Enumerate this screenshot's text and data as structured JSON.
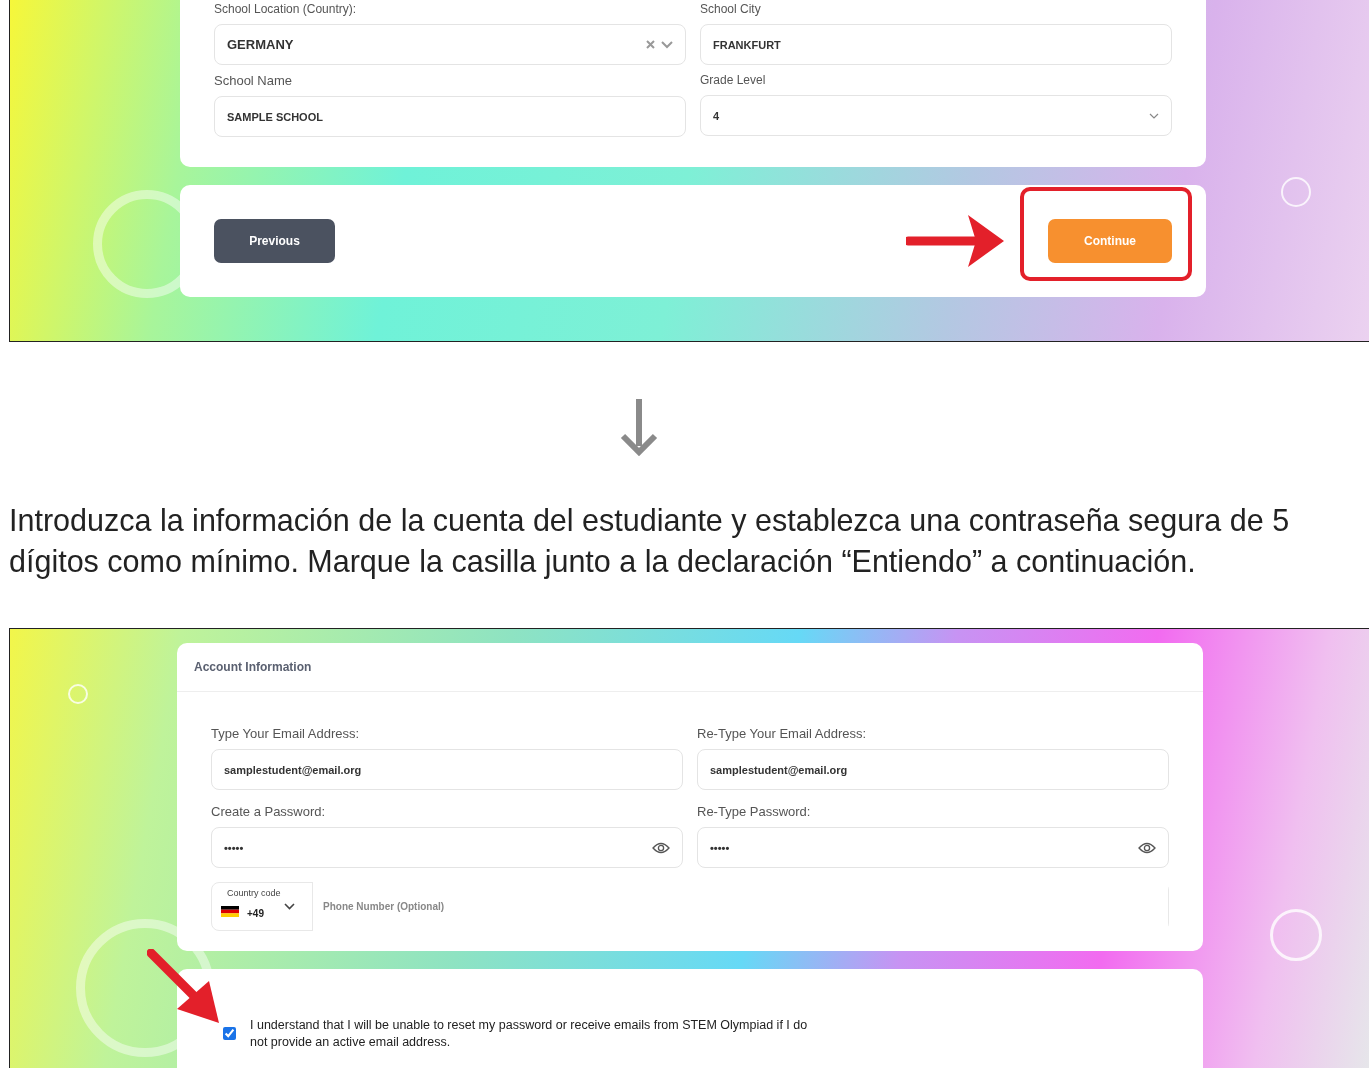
{
  "school_form": {
    "fields": [
      {
        "label": "School Location (Country):",
        "value": "GERMANY",
        "kind": "combo"
      },
      {
        "label": "School City",
        "value": "FRANKFURT",
        "kind": "text"
      },
      {
        "label": "School Name",
        "value": "SAMPLE SCHOOL",
        "kind": "text"
      },
      {
        "label": "Grade Level",
        "value": "4",
        "kind": "select"
      }
    ],
    "buttons": [
      {
        "label": "Previous",
        "kind": "secondary",
        "highlighted": false
      },
      {
        "label": "Continue",
        "kind": "primary",
        "highlighted": true
      }
    ]
  },
  "instruction": "Introduzca la información de la cuenta del estudiante y establezca una contraseña segura de 5 dígitos como mínimo. Marque la casilla junto a la declaración “Entiendo” a continuación.",
  "account_form": {
    "title": "Account Information",
    "fields": [
      {
        "label": "Type Your Email Address:",
        "value": "samplestudent@email.org",
        "kind": "text"
      },
      {
        "label": "Re-Type Your Email Address:",
        "value": "samplestudent@email.org",
        "kind": "text"
      },
      {
        "label": "Create a Password:",
        "value": "•••••",
        "kind": "password"
      },
      {
        "label": "Re-Type Password:",
        "value": "•••••",
        "kind": "password"
      }
    ],
    "phone": {
      "country_label": "Country code",
      "country_code": "+49",
      "placeholder": "Phone Number (Optional)"
    },
    "agreement": {
      "text": "I understand that I will be unable to reset my password or receive emails from STEM Olympiad if I do not provide an active email address.",
      "checked": true,
      "highlighted": true
    }
  }
}
